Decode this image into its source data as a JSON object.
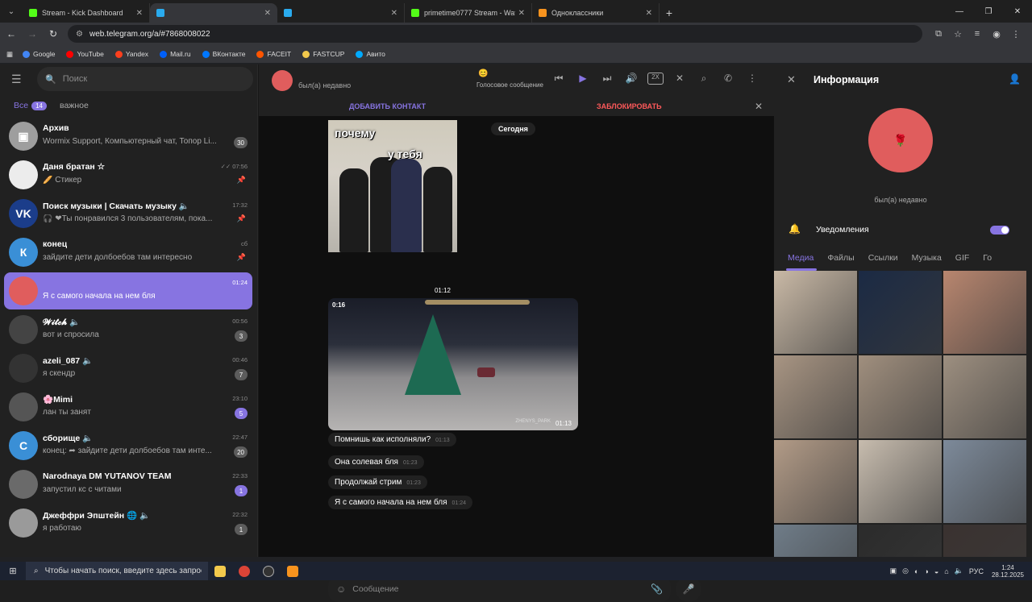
{
  "browser": {
    "tabs": [
      {
        "title": "Stream - Kick Dashboard",
        "color": "#53fc18",
        "active": false
      },
      {
        "title": "",
        "color": "#2aabee",
        "active": true
      },
      {
        "title": "",
        "color": "#2aabee",
        "active": false
      },
      {
        "title": "primetime0777 Stream - Watch",
        "color": "#53fc18",
        "active": false
      },
      {
        "title": "Одноклассники",
        "color": "#f7931e",
        "active": false
      }
    ],
    "url": "web.telegram.org/a/#7868008022",
    "bookmarks": [
      {
        "label": "Google",
        "color": "#4285f4"
      },
      {
        "label": "YouTube",
        "color": "#ff0000"
      },
      {
        "label": "Yandex",
        "color": "#fc3f1d"
      },
      {
        "label": "Mail.ru",
        "color": "#005ff9"
      },
      {
        "label": "ВКонтакте",
        "color": "#0077ff"
      },
      {
        "label": "FACEIT",
        "color": "#ff5500"
      },
      {
        "label": "FASTCUP",
        "color": "#f2c94c"
      },
      {
        "label": "Авито",
        "color": "#00aaff"
      }
    ]
  },
  "sidebar": {
    "search_placeholder": "Поиск",
    "folders": [
      {
        "label": "Все",
        "count": "14",
        "active": true
      },
      {
        "label": "важное",
        "count": "",
        "active": false
      }
    ],
    "chats": [
      {
        "name": "Архив",
        "preview": "Wormix Support, Компьютерный чат, Топор Li...",
        "time": "",
        "badge": "30",
        "badge_color": "#5c5c5c",
        "pinned": false,
        "avatar_color": "#9e9e9e",
        "avatar_text": "▣"
      },
      {
        "name": "Даня братан ☆",
        "preview": "🥖 Стикер",
        "time": "✓✓ 07:56",
        "badge": "",
        "badge_color": "",
        "pinned": true,
        "avatar_color": "#ececec",
        "avatar_text": ""
      },
      {
        "name": "Поиск музыки | Скачать музыку 🔈",
        "preview": "🎧 ❤Ты понравился 3 пользователям, пока...",
        "time": "17:32",
        "badge": "",
        "badge_color": "",
        "pinned": true,
        "avatar_color": "#1b3d8a",
        "avatar_text": "VK"
      },
      {
        "name": "конец",
        "preview": "зайдите дети долбоебов там интересно",
        "time": "сб",
        "badge": "",
        "badge_color": "",
        "pinned": true,
        "avatar_color": "#3a8fd6",
        "avatar_text": "К"
      },
      {
        "name": "",
        "preview": "Я с самого начала на нем бля",
        "time": "01:24",
        "badge": "",
        "badge_color": "",
        "pinned": false,
        "avatar_color": "#e05d5d",
        "avatar_text": "",
        "selected": true
      },
      {
        "name": "𝓦𝓲𝓽𝓬𝓱 🔈",
        "preview": "вот и спросила",
        "time": "00:56",
        "badge": "3",
        "badge_color": "#5c5c5c",
        "pinned": false,
        "avatar_color": "#444",
        "avatar_text": ""
      },
      {
        "name": "azeli_087 🔈",
        "preview": "я скендр",
        "time": "00:46",
        "badge": "7",
        "badge_color": "#5c5c5c",
        "pinned": false,
        "avatar_color": "#333",
        "avatar_text": ""
      },
      {
        "name": "🌸Mimi",
        "preview": "лан ты занят",
        "time": "23:10",
        "badge": "5",
        "badge_color": "#8774e1",
        "pinned": false,
        "avatar_color": "#555",
        "avatar_text": ""
      },
      {
        "name": "сборище 🔈",
        "preview": "конец: ➦ зайдите дети долбоебов там инте...",
        "time": "22:47",
        "badge": "20",
        "badge_color": "#5c5c5c",
        "pinned": false,
        "avatar_color": "#3a8fd6",
        "avatar_text": "С"
      },
      {
        "name": "Narodnaya DM YUTANOV TEAM",
        "preview": "запустил кс с читами",
        "time": "22:33",
        "badge": "1",
        "badge_color": "#8774e1",
        "pinned": false,
        "avatar_color": "#6a6a6a",
        "avatar_text": ""
      },
      {
        "name": "Джеффри Эпштейн 🌐 🔈",
        "preview": "я работаю",
        "time": "22:32",
        "badge": "1",
        "badge_color": "#5c5c5c",
        "pinned": false,
        "avatar_color": "#9a9a9a",
        "avatar_text": ""
      }
    ]
  },
  "chat": {
    "status": "был(а) недавно",
    "voice_label": "Голосовое сообщение",
    "speed": "2X",
    "add_contact": "ДОБАВИТЬ КОНТАКТ",
    "block": "ЗАБЛОКИРОВАТЬ",
    "date": "Сегодня",
    "sticker_caption_1": "почему",
    "sticker_caption_2": "у тебя",
    "sticker_time": "01:12",
    "video_duration": "0:16",
    "video_time": "01:13",
    "video_watermark": "ZHENYS_PARK",
    "messages": [
      {
        "text": "Помнишь как исполняли?",
        "time": "01:13"
      },
      {
        "text": "Она солевая бля",
        "time": "01:23"
      },
      {
        "text": "Продолжай стрим",
        "time": "01:23"
      },
      {
        "text": "Я с самого начала на нем бля",
        "time": "01:24"
      }
    ],
    "composer_placeholder": "Сообщение"
  },
  "info": {
    "title": "Информация",
    "status": "был(а) недавно",
    "notifications_label": "Уведомления",
    "notifications_on": true,
    "tabs": [
      "Медиа",
      "Файлы",
      "Ссылки",
      "Музыка",
      "GIF",
      "Го"
    ],
    "media_colors": [
      "#c9b9a6",
      "#1b2a44",
      "#b8866f",
      "#a89583",
      "#a08f7e",
      "#9d8f80",
      "#b29b87",
      "#c7bcae",
      "#7d8a9a",
      "#6f7c88",
      "#2b2b2b",
      "#3a3230"
    ]
  },
  "taskbar": {
    "search_text": "Чтобы начать поиск, введите здесь запрос",
    "lang": "РУС",
    "time": "1:24",
    "date": "28.12.2025"
  }
}
